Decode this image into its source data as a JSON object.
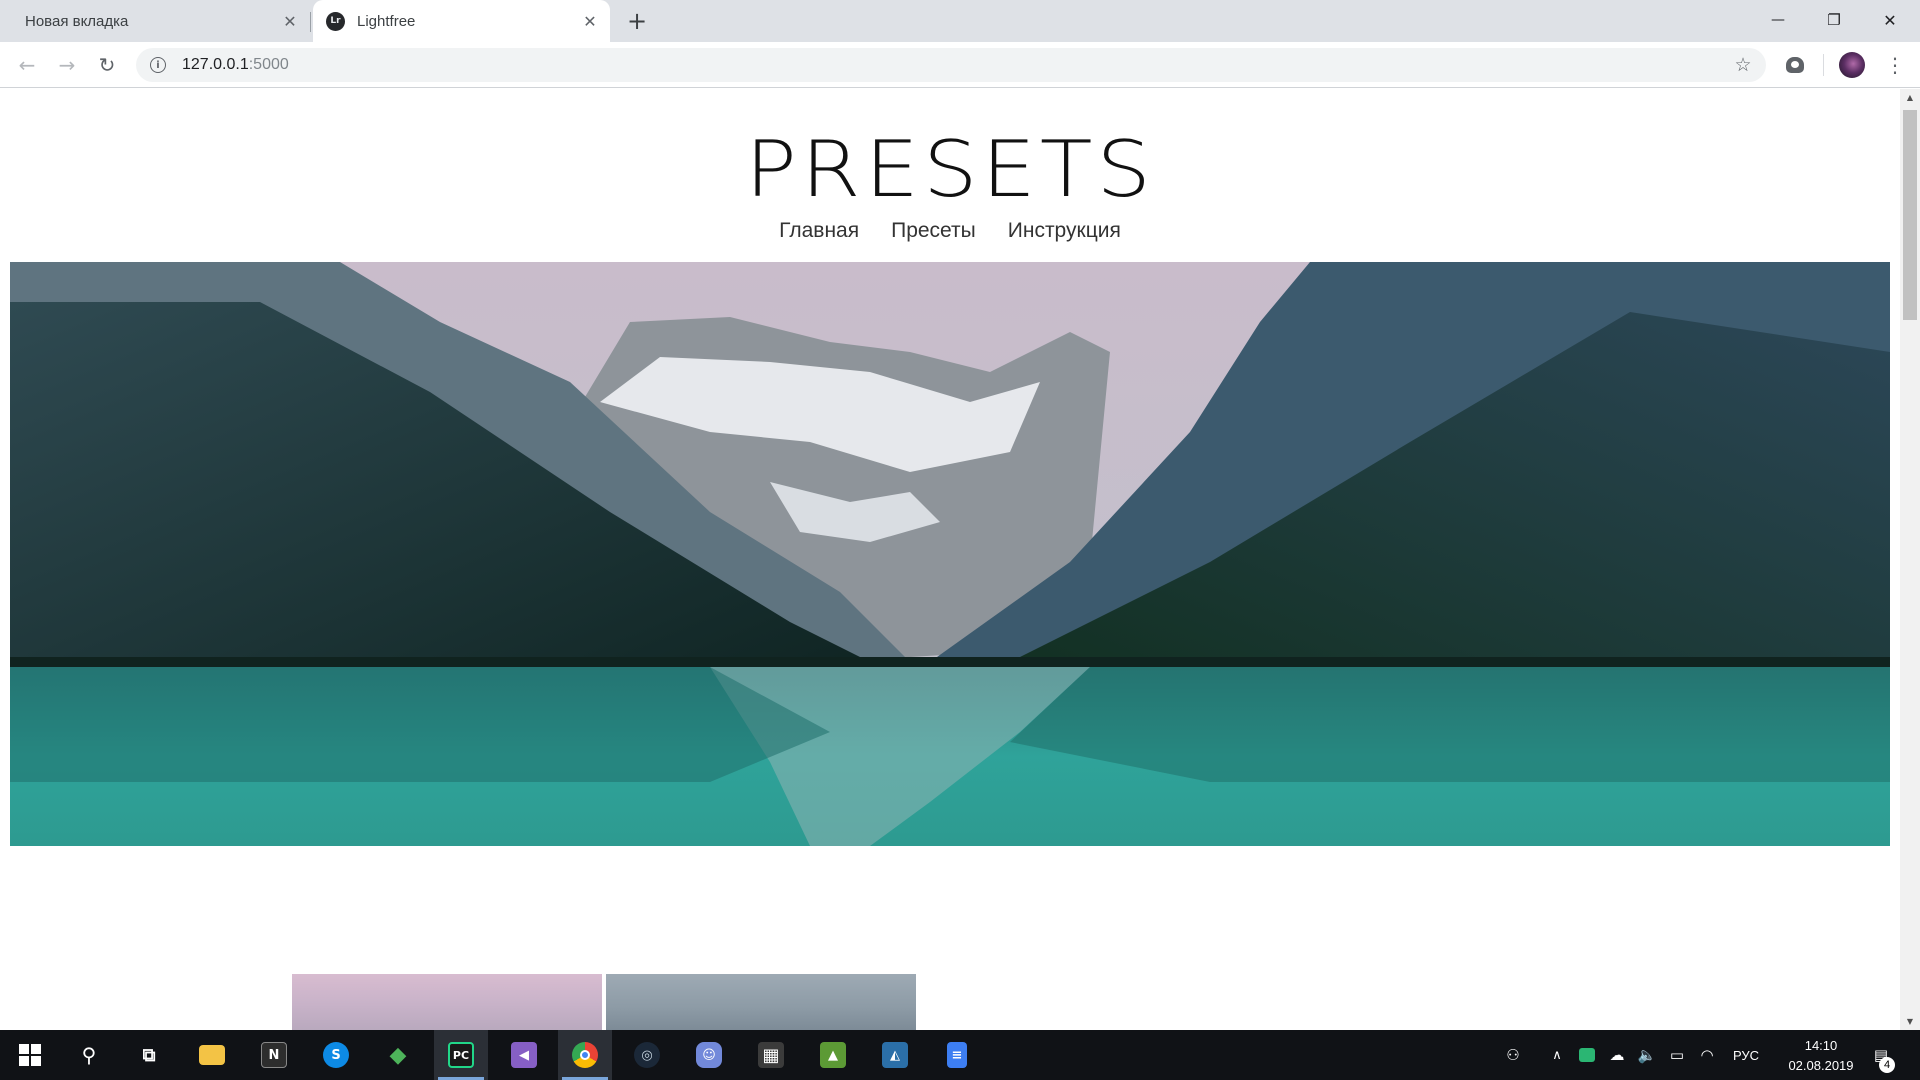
{
  "browser": {
    "tabs": [
      {
        "title": "Новая вкладка",
        "active": false
      },
      {
        "title": "Lightfree",
        "active": true,
        "favicon_text": "Lr"
      }
    ],
    "close_glyph": "✕",
    "newtab_glyph": "+",
    "window_controls": {
      "minimize": "—",
      "restore": "❐",
      "close": "✕"
    },
    "nav": {
      "back": "←",
      "forward": "→",
      "reload": "↻"
    },
    "address": {
      "host": "127.0.0.1",
      "port": ":5000"
    },
    "info_glyph": "i",
    "star_glyph": "☆",
    "menu_glyph": "⋮"
  },
  "page": {
    "logo": "PRESETS",
    "nav": [
      "Главная",
      "Пресеты",
      "Инструкция"
    ],
    "hero_image": "mountain-lake-landscape",
    "thumbnails": [
      "preset-thumbnail-pink-sky",
      "preset-thumbnail-grey-sky"
    ]
  },
  "taskbar": {
    "apps": [
      {
        "name": "search",
        "glyph": "⚲"
      },
      {
        "name": "task-view",
        "glyph": "⧉"
      },
      {
        "name": "file-explorer",
        "color": "#f3c345"
      },
      {
        "name": "notion",
        "glyph": "N",
        "color": "#2d2d2d"
      },
      {
        "name": "skype",
        "glyph": "S",
        "color": "#0d8ae5"
      },
      {
        "name": "git-kraken",
        "glyph": "◆",
        "color": "#4db35a"
      },
      {
        "name": "pycharm",
        "glyph": "PC",
        "color": "#1a1a1a"
      },
      {
        "name": "visual-studio",
        "glyph": "◀",
        "color": "#865fc5"
      },
      {
        "name": "chrome",
        "color": "#4285f4"
      },
      {
        "name": "steam",
        "glyph": "◎",
        "color": "#1b2838"
      },
      {
        "name": "discord",
        "glyph": "☺",
        "color": "#7289da"
      },
      {
        "name": "calculator",
        "glyph": "▦",
        "color": "#3b3b3b"
      },
      {
        "name": "minecraft",
        "glyph": "▲",
        "color": "#5c9a35"
      },
      {
        "name": "mysql-workbench",
        "glyph": "◭",
        "color": "#2b6fa8"
      },
      {
        "name": "google-docs",
        "glyph": "≡",
        "color": "#3d7ef2"
      }
    ],
    "tray": {
      "language": "РУС",
      "time": "14:10",
      "date": "02.08.2019",
      "notifications": "4"
    }
  },
  "colors": {
    "tabstrip": "#dee1e6",
    "taskbar": "#101216",
    "taskbar_accent": "#7aa6db"
  }
}
